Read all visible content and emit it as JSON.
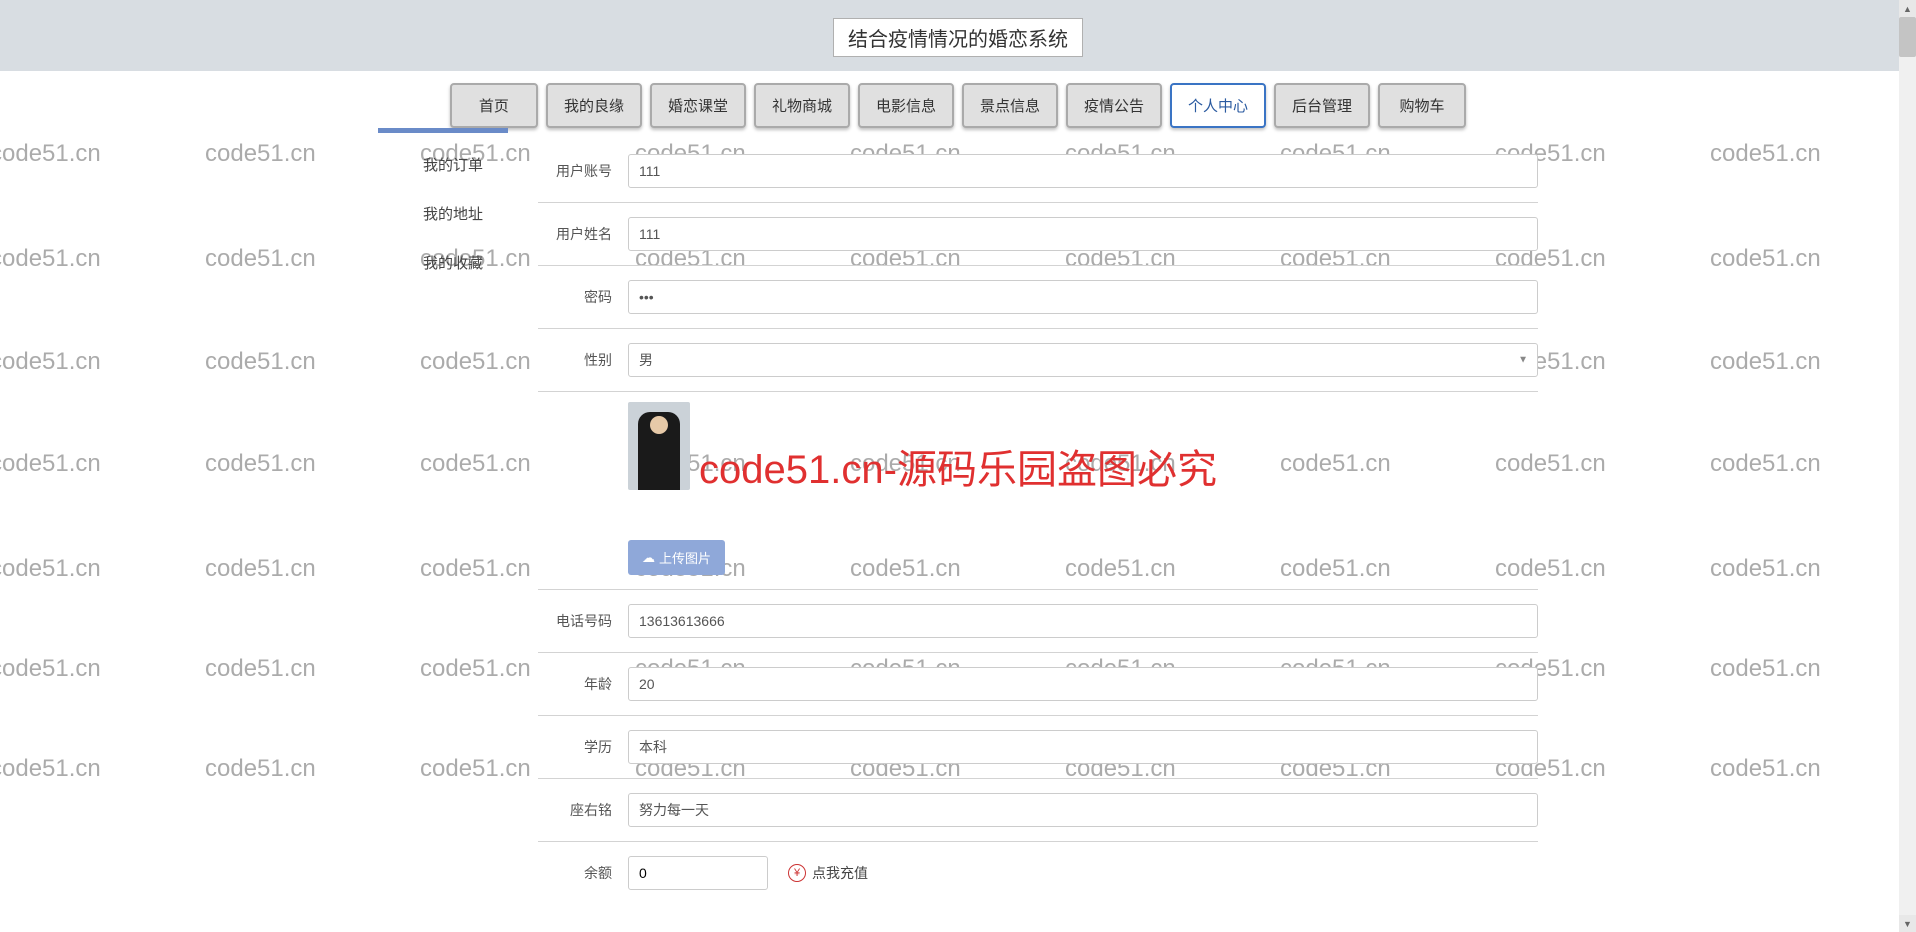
{
  "banner": {
    "title": "结合疫情情况的婚恋系统"
  },
  "nav": [
    {
      "label": "首页",
      "active": false
    },
    {
      "label": "我的良缘",
      "active": false
    },
    {
      "label": "婚恋课堂",
      "active": false
    },
    {
      "label": "礼物商城",
      "active": false
    },
    {
      "label": "电影信息",
      "active": false
    },
    {
      "label": "景点信息",
      "active": false
    },
    {
      "label": "疫情公告",
      "active": false
    },
    {
      "label": "个人中心",
      "active": true
    },
    {
      "label": "后台管理",
      "active": false
    },
    {
      "label": "购物车",
      "active": false
    }
  ],
  "sidebar": {
    "items": [
      "我的订单",
      "我的地址",
      "我的收藏"
    ]
  },
  "form": {
    "account_label": "用户账号",
    "account_value": "111",
    "name_label": "用户姓名",
    "name_value": "111",
    "password_label": "密码",
    "password_value": "•••",
    "gender_label": "性别",
    "gender_value": "男",
    "upload_label": "上传图片",
    "phone_label": "电话号码",
    "phone_value": "13613613666",
    "age_label": "年龄",
    "age_value": "20",
    "education_label": "学历",
    "education_value": "本科",
    "motto_label": "座右铭",
    "motto_value": "努力每一天",
    "balance_label": "余额",
    "balance_value": "0",
    "recharge_label": "点我充值"
  },
  "watermark": {
    "text": "code51.cn",
    "big_text": "code51.cn-源码乐园盗图必究"
  }
}
